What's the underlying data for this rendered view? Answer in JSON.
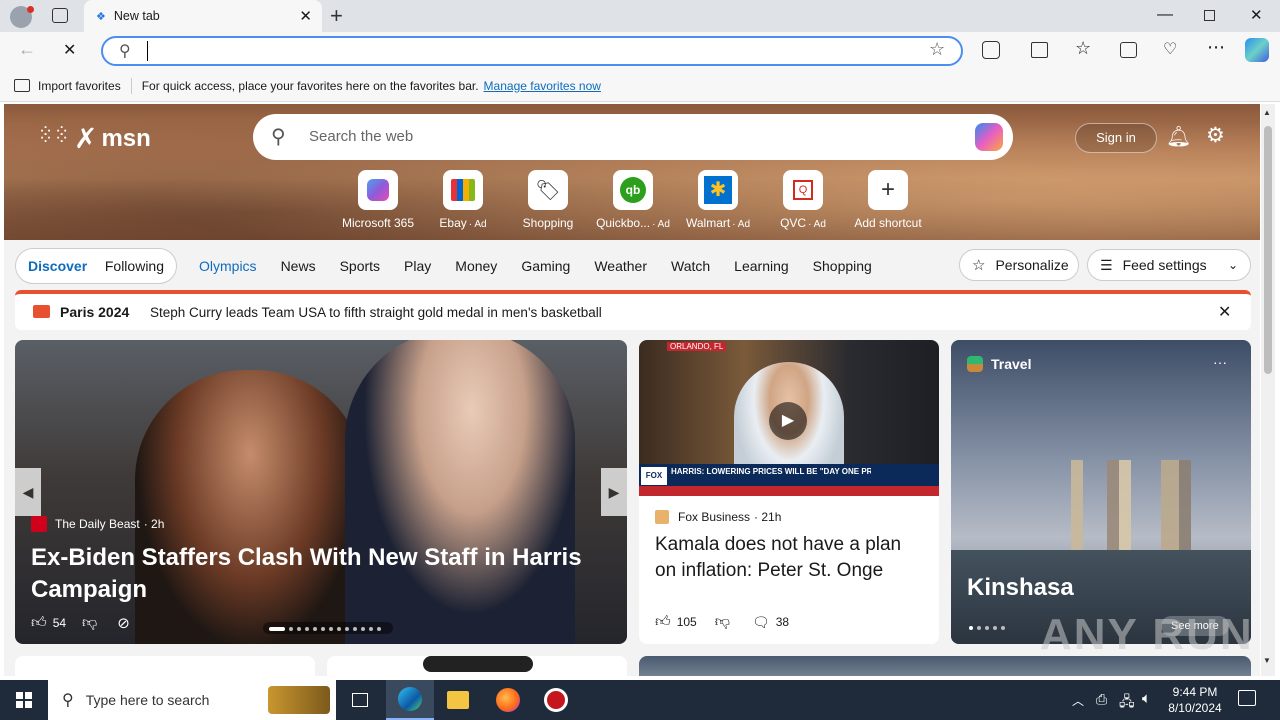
{
  "browser": {
    "tab_title": "New tab",
    "address_value": "",
    "favorites_bar": {
      "import_label": "Import favorites",
      "hint_text": "For quick access, place your favorites here on the favorites bar.",
      "manage_link": "Manage favorites now"
    }
  },
  "msn": {
    "logo_text": "msn",
    "search_placeholder": "Search the web",
    "sign_in_label": "Sign in",
    "shortcuts": [
      {
        "label": "Microsoft 365",
        "ad": ""
      },
      {
        "label": "Ebay",
        "ad": "· Ad"
      },
      {
        "label": "Shopping",
        "ad": ""
      },
      {
        "label": "Quickbo...",
        "ad": "· Ad"
      },
      {
        "label": "Walmart",
        "ad": "· Ad"
      },
      {
        "label": "QVC",
        "ad": "· Ad"
      },
      {
        "label": "Add shortcut",
        "ad": ""
      }
    ],
    "feed_tabs": {
      "discover": "Discover",
      "following": "Following",
      "categories": [
        "Olympics",
        "News",
        "Sports",
        "Play",
        "Money",
        "Gaming",
        "Weather",
        "Watch",
        "Learning",
        "Shopping"
      ],
      "more": "···",
      "personalize": "Personalize",
      "feed_settings": "Feed settings"
    },
    "banner": {
      "tag": "Paris 2024",
      "text": "Steph Curry leads Team USA to fifth straight gold medal in men's basketball"
    },
    "main_story": {
      "source": "The Daily Beast",
      "age": "· 2h",
      "headline": "Ex-Biden Staffers Clash With New Staff in Harris Campaign",
      "likes": "54"
    },
    "video_story": {
      "overlay_location": "ORLANDO, FL",
      "ticker": "HARRIS: LOWERING PRICES WILL BE \"DAY ONE PRIORITY\"",
      "source": "Fox Business",
      "age": "· 21h",
      "headline": "Kamala does not have a plan on inflation: Peter St. Onge",
      "likes": "105",
      "comments": "38"
    },
    "travel_card": {
      "label": "Travel",
      "place": "Kinshasa",
      "see_more": "See more"
    }
  },
  "taskbar": {
    "search_placeholder": "Type here to search",
    "time": "9:44 PM",
    "date": "8/10/2024"
  },
  "watermark": "ANY RUN",
  "colors": {
    "accent": "#0f6cbd",
    "olympics_blue": "#0f6cbd",
    "banner_red": "#e8512f",
    "taskbar": "#1f2b3a"
  }
}
